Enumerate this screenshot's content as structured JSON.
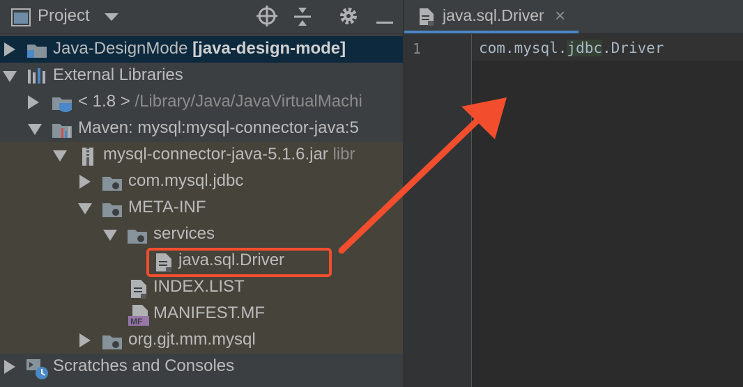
{
  "project_panel": {
    "title": "Project",
    "tree": [
      {
        "label": "Java-DesignMode",
        "extra": "[java-design-mode]"
      },
      {
        "label": "External Libraries"
      },
      {
        "label": "< 1.8 >",
        "extra": "/Library/Java/JavaVirtualMachi"
      },
      {
        "label": "Maven: mysql:mysql-connector-java:5"
      },
      {
        "label": "mysql-connector-java-5.1.6.jar",
        "extra": "libr"
      },
      {
        "label": "com.mysql.jdbc"
      },
      {
        "label": "META-INF"
      },
      {
        "label": "services"
      },
      {
        "label": "java.sql.Driver"
      },
      {
        "label": "INDEX.LIST"
      },
      {
        "label": "MANIFEST.MF",
        "badge": "MF"
      },
      {
        "label": "org.gjt.mm.mysql"
      },
      {
        "label": "Scratches and Consoles"
      }
    ]
  },
  "editor": {
    "tab_label": "java.sql.Driver",
    "tab_close": "×",
    "line_number": "1",
    "code_before": "com.mysql.",
    "code_highlight": "jdbc",
    "code_after": ".Driver"
  },
  "annotation": {
    "color": "#f24e2e"
  }
}
